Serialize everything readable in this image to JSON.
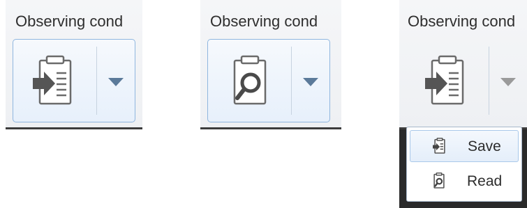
{
  "panels": [
    {
      "title": "Observing cond",
      "main_icon": "clipboard-save-icon",
      "state": "hover"
    },
    {
      "title": "Observing cond",
      "main_icon": "clipboard-read-icon",
      "state": "hover"
    },
    {
      "title": "Observing cond",
      "main_icon": "clipboard-save-icon",
      "state": "pressed"
    }
  ],
  "dropdown_menu": {
    "items": [
      {
        "label": "Save",
        "icon": "clipboard-save-icon"
      },
      {
        "label": "Read",
        "icon": "clipboard-read-icon"
      }
    ]
  },
  "colors": {
    "hover_border": "#8fb6df",
    "arrow": "#5b7a9a",
    "text": "#2e2e2e"
  }
}
